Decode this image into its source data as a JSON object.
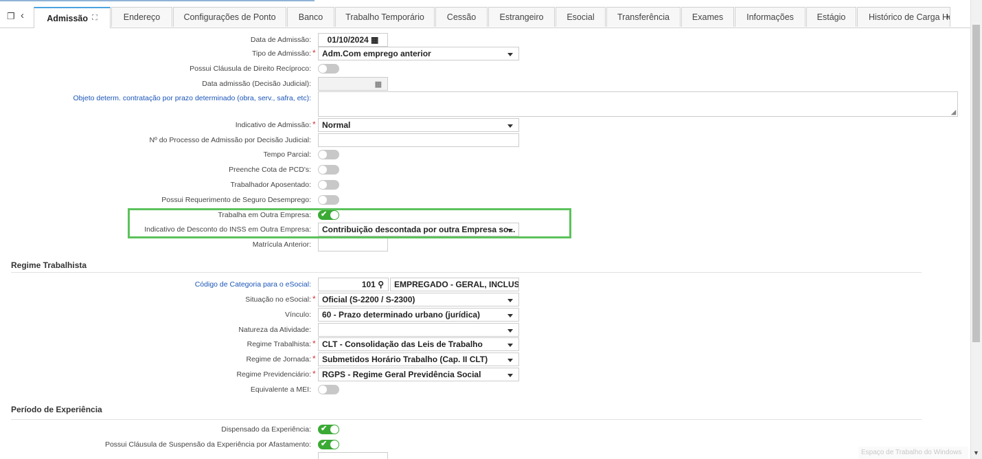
{
  "tabs": [
    {
      "label": "Admissão",
      "active": true
    },
    {
      "label": "Endereço"
    },
    {
      "label": "Configurações de Ponto"
    },
    {
      "label": "Banco"
    },
    {
      "label": "Trabalho Temporário"
    },
    {
      "label": "Cessão"
    },
    {
      "label": "Estrangeiro"
    },
    {
      "label": "Esocial"
    },
    {
      "label": "Transferência"
    },
    {
      "label": "Exames"
    },
    {
      "label": "Informações"
    },
    {
      "label": "Estágio"
    },
    {
      "label": "Histórico de Carga Ho"
    }
  ],
  "admissao": {
    "data_admissao": {
      "label": "Data de Admissão:",
      "value": "01/10/2024"
    },
    "tipo_admissao": {
      "label": "Tipo de Admissão:",
      "value": "Adm.Com emprego anterior"
    },
    "clausula_reciproco": {
      "label": "Possui Cláusula de Direito Recíproco:",
      "on": false
    },
    "data_admissao_judicial": {
      "label": "Data admissão (Decisão Judicial):",
      "value": ""
    },
    "objeto_determ": {
      "label": "Objeto determ. contratação por prazo determinado (obra, serv., safra, etc):",
      "value": ""
    },
    "indicativo_admissao": {
      "label": "Indicativo de Admissão:",
      "value": "Normal"
    },
    "num_processo": {
      "label": "Nº do Processo de Admissão por Decisão Judicial:",
      "value": ""
    },
    "tempo_parcial": {
      "label": "Tempo Parcial:",
      "on": false
    },
    "cota_pcd": {
      "label": "Preenche Cota de PCD's:",
      "on": false
    },
    "aposentado": {
      "label": "Trabalhador Aposentado:",
      "on": false
    },
    "seguro_desemprego": {
      "label": "Possui Requerimento de Seguro Desemprego:",
      "on": false
    },
    "outra_empresa": {
      "label": "Trabalha em Outra Empresa:",
      "on": true
    },
    "desconto_inss": {
      "label": "Indicativo de Desconto do INSS em Outra Empresa:",
      "value": "Contribuição descontada por outra Empresa so..."
    },
    "matricula_anterior": {
      "label": "Matrícula Anterior:",
      "value": ""
    }
  },
  "regime": {
    "title": "Regime Trabalhista",
    "codigo_categoria": {
      "label": "Código de Categoria para o eSocial:",
      "code": "101",
      "desc": "EMPREGADO - GERAL, INCLUSI"
    },
    "situacao": {
      "label": "Situação no eSocial:",
      "value": "Oficial (S-2200 / S-2300)"
    },
    "vinculo": {
      "label": "Vínculo:",
      "value": "60 - Prazo determinado urbano (jurídica)"
    },
    "natureza": {
      "label": "Natureza da Atividade:",
      "value": ""
    },
    "regime_trab": {
      "label": "Regime Trabalhista:",
      "value": "CLT - Consolidação das Leis de Trabalho"
    },
    "jornada": {
      "label": "Regime de Jornada:",
      "value": "Submetidos Horário Trabalho (Cap. II CLT)"
    },
    "previdenciario": {
      "label": "Regime Previdenciário:",
      "value": "RGPS - Regime Geral Previdência Social"
    },
    "mei": {
      "label": "Equivalente a MEI:",
      "on": false
    }
  },
  "experiencia": {
    "title": "Período de Experiência",
    "dispensado": {
      "label": "Dispensado da Experiência:",
      "on": true
    },
    "suspensao": {
      "label": "Possui Cláusula de Suspensão da Experiência por Afastamento:",
      "on": true
    }
  },
  "watermark": "Espaço de Trabalho do Windows"
}
